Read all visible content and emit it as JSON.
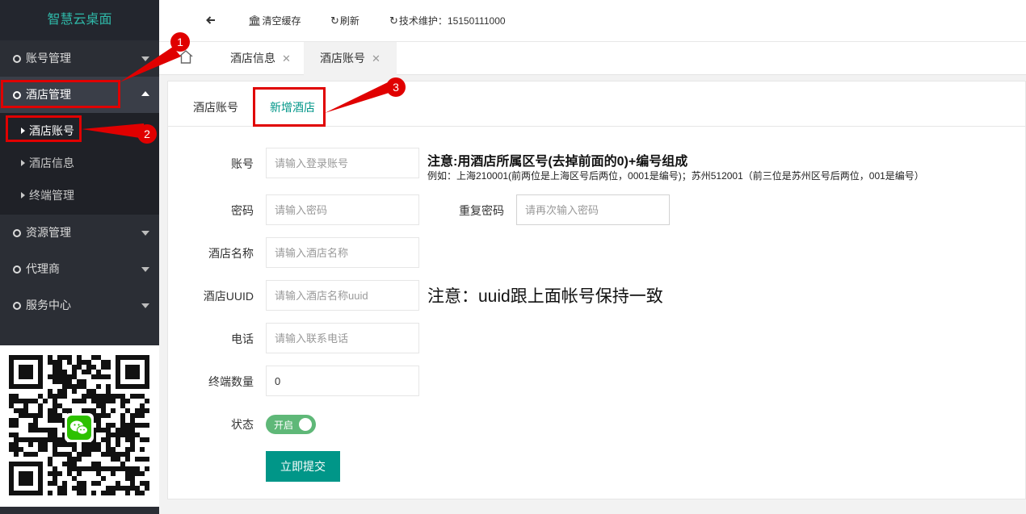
{
  "sidebar": {
    "logo": "智慧云桌面",
    "items": [
      {
        "label": "账号管理"
      },
      {
        "label": "酒店管理"
      },
      {
        "label": "资源管理"
      },
      {
        "label": "代理商"
      },
      {
        "label": "服务中心"
      }
    ],
    "sub_items": [
      {
        "label": "酒店账号"
      },
      {
        "label": "酒店信息"
      },
      {
        "label": "终端管理"
      }
    ]
  },
  "header": {
    "clear_cache": "清空缓存",
    "refresh": "刷新",
    "support": "技术维护：15150111000"
  },
  "tabs": [
    {
      "label": "酒店信息"
    },
    {
      "label": "酒店账号"
    }
  ],
  "subtabs": [
    {
      "label": "酒店账号"
    },
    {
      "label": "新增酒店"
    }
  ],
  "form": {
    "account": {
      "label": "账号",
      "placeholder": "请输入登录账号"
    },
    "password": {
      "label": "密码",
      "placeholder": "请输入密码"
    },
    "repeat_password": {
      "label": "重复密码",
      "placeholder": "请再次输入密码"
    },
    "hotel_name": {
      "label": "酒店名称",
      "placeholder": "请输入酒店名称"
    },
    "hotel_uuid": {
      "label": "酒店UUID",
      "placeholder": "请输入酒店名称uuid"
    },
    "phone": {
      "label": "电话",
      "placeholder": "请输入联系电话"
    },
    "terminal_count": {
      "label": "终端数量",
      "value": "0"
    },
    "status": {
      "label": "状态",
      "value": "开启"
    },
    "submit": "立即提交"
  },
  "notes": {
    "account_title": "注意:用酒店所属区号(去掉前面的0)+编号组成",
    "account_example": "例如：上海210001(前两位是上海区号后两位，0001是编号)；苏州512001（前三位是苏州区号后两位，001是编号）",
    "uuid_note": "注意：uuid跟上面帐号保持一致"
  },
  "annotations": [
    "1",
    "2",
    "3"
  ],
  "colors": {
    "sidebar_bg": "#2b2e35",
    "accent": "#009688",
    "switch_on": "#5fb878",
    "annotation_red": "#e00000"
  }
}
